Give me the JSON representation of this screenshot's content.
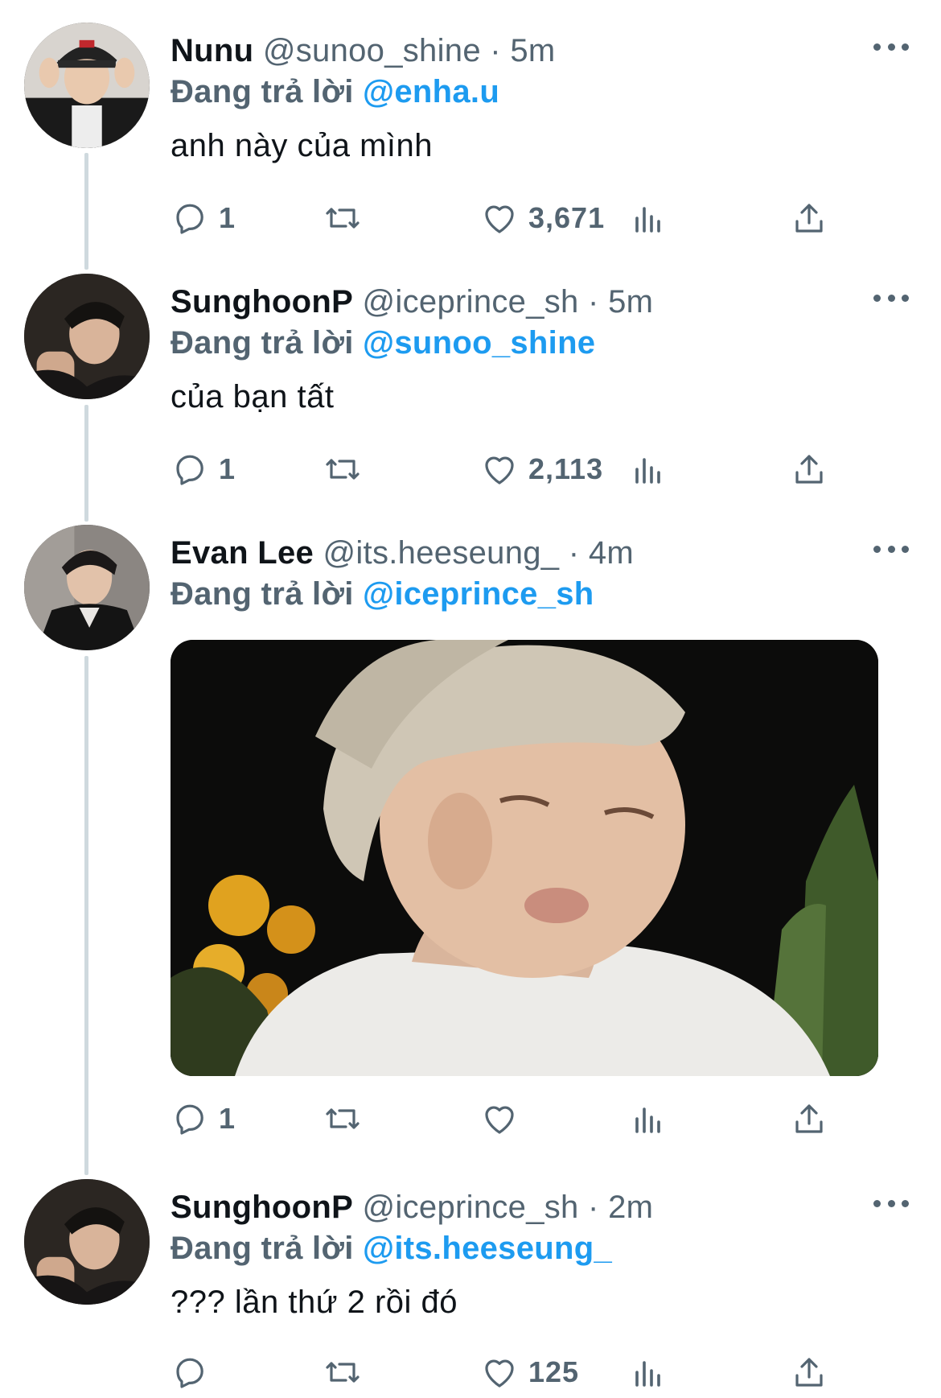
{
  "tweets": [
    {
      "display_name": "Nunu",
      "handle": "@sunoo_shine",
      "separator": "·",
      "time": "5m",
      "reply_prefix": "Đang trả lời",
      "reply_to": "@enha.u",
      "text": "anh này của mình",
      "reply_count": "1",
      "like_count": "3,671"
    },
    {
      "display_name": "SunghoonP",
      "handle": "@iceprince_sh",
      "separator": "·",
      "time": "5m",
      "reply_prefix": "Đang trả lời",
      "reply_to": "@sunoo_shine",
      "text": "của bạn tất",
      "reply_count": "1",
      "like_count": "2,113"
    },
    {
      "display_name": "Evan Lee",
      "handle": "@its.heeseung_",
      "separator": "·",
      "time": "4m",
      "reply_prefix": "Đang trả lời",
      "reply_to": "@iceprince_sh",
      "reply_count": "1"
    },
    {
      "display_name": "SunghoonP",
      "handle": "@iceprince_sh",
      "separator": "·",
      "time": "2m",
      "reply_prefix": "Đang trả lời",
      "reply_to": "@its.heeseung_",
      "text": "??? lần thứ 2 rồi đó",
      "like_count": "125"
    }
  ],
  "icons": {
    "reply": "reply-icon",
    "retweet": "retweet-icon",
    "like": "heart-icon",
    "views": "views-icon",
    "share": "share-icon",
    "more": "more-icon"
  },
  "colors": {
    "link": "#1d9bf0",
    "secondary_text": "#536471",
    "primary_text": "#0f1419",
    "thread_line": "#cfd9de"
  }
}
